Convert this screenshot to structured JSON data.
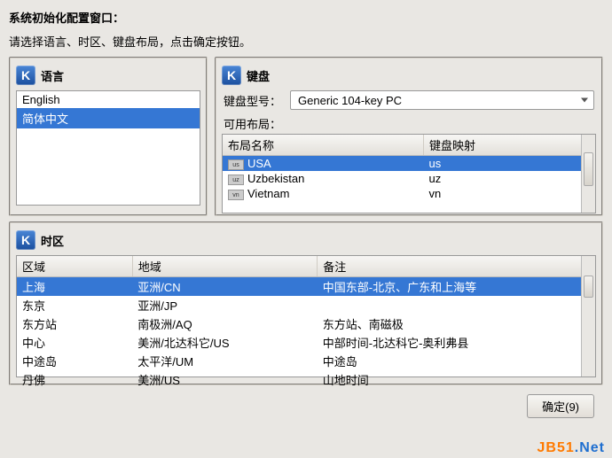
{
  "header": {
    "title": "系统初始化配置窗口：",
    "subtitle": "请选择语言、时区、键盘布局，点击确定按钮。"
  },
  "language": {
    "panel_title": "语言",
    "items": [
      "English",
      "简体中文"
    ],
    "selected_index": 1
  },
  "keyboard": {
    "panel_title": "键盘",
    "model_label": "键盘型号：",
    "model_value": "Generic 104-key PC",
    "layouts_label": "可用布局：",
    "columns": {
      "name": "布局名称",
      "mapping": "键盘映射"
    },
    "rows": [
      {
        "flag": "us",
        "name": "USA",
        "mapping": "us",
        "selected": true
      },
      {
        "flag": "uz",
        "name": "Uzbekistan",
        "mapping": "uz",
        "selected": false
      },
      {
        "flag": "vn",
        "name": "Vietnam",
        "mapping": "vn",
        "selected": false
      }
    ]
  },
  "timezone": {
    "panel_title": "时区",
    "columns": {
      "region": "区域",
      "area": "地域",
      "note": "备注"
    },
    "rows": [
      {
        "region": "上海",
        "area": "亚洲/CN",
        "note": "中国东部-北京、广东和上海等",
        "selected": true
      },
      {
        "region": "东京",
        "area": "亚洲/JP",
        "note": "",
        "selected": false
      },
      {
        "region": "东方站",
        "area": "南极洲/AQ",
        "note": "东方站、南磁极",
        "selected": false
      },
      {
        "region": "中心",
        "area": "美洲/北达科它/US",
        "note": "中部时间-北达科它-奥利弗县",
        "selected": false
      },
      {
        "region": "中途岛",
        "area": "太平洋/UM",
        "note": "中途岛",
        "selected": false
      },
      {
        "region": "丹佛",
        "area": "美洲/US",
        "note": "山地时间",
        "selected": false
      }
    ]
  },
  "buttons": {
    "ok": "确定(9)"
  },
  "watermark": {
    "a": "JB51",
    "b": ".Net"
  }
}
